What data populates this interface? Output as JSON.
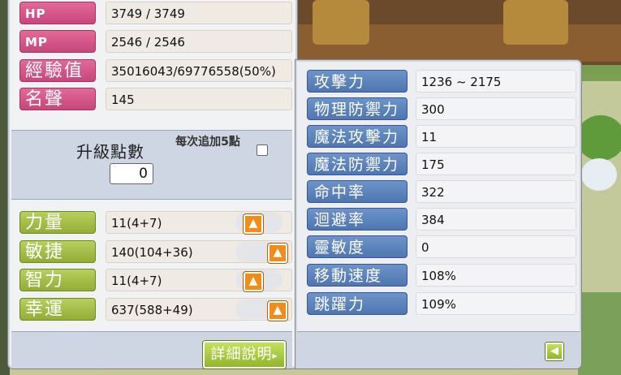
{
  "colors": {
    "pink_label": "#d55789",
    "green_label": "#a6bf49",
    "blue_label": "#5f85bf",
    "up_button": "#f18c1a",
    "panel_band": "#cfd6e3"
  },
  "stats": {
    "rows": [
      {
        "label": "HP",
        "value": "3749 / 3749"
      },
      {
        "label": "MP",
        "value": "2546 / 2546"
      },
      {
        "label": "經驗值",
        "value": "35016043/69776558(50%)"
      },
      {
        "label": "名聲",
        "value": "145"
      }
    ]
  },
  "ap": {
    "label": "升級點數",
    "value": "0",
    "per_add_label": "每次追加5點",
    "per_add_checked": false
  },
  "attributes": [
    {
      "label": "力量",
      "value": "11(4+7)",
      "up_icon": "arrow-up-icon"
    },
    {
      "label": "敏捷",
      "value": "140(104+36)",
      "up_icon": "arrow-up-icon"
    },
    {
      "label": "智力",
      "value": "11(4+7)",
      "up_icon": "arrow-up-icon"
    },
    {
      "label": "幸運",
      "value": "637(588+49)",
      "up_icon": "arrow-up-icon"
    }
  ],
  "detail_button": {
    "label": "詳細說明"
  },
  "details": [
    {
      "label": "攻擊力",
      "value": "1236 ~ 2175"
    },
    {
      "label": "物理防禦力",
      "value": "300"
    },
    {
      "label": "魔法攻擊力",
      "value": "11"
    },
    {
      "label": "魔法防禦力",
      "value": "175"
    },
    {
      "label": "命中率",
      "value": "322"
    },
    {
      "label": "迴避率",
      "value": "384"
    },
    {
      "label": "靈敏度",
      "value": "0"
    },
    {
      "label": "移動速度",
      "value": "108%"
    },
    {
      "label": "跳躍力",
      "value": "109%"
    }
  ],
  "back_button": {
    "icon": "arrow-left-icon"
  }
}
